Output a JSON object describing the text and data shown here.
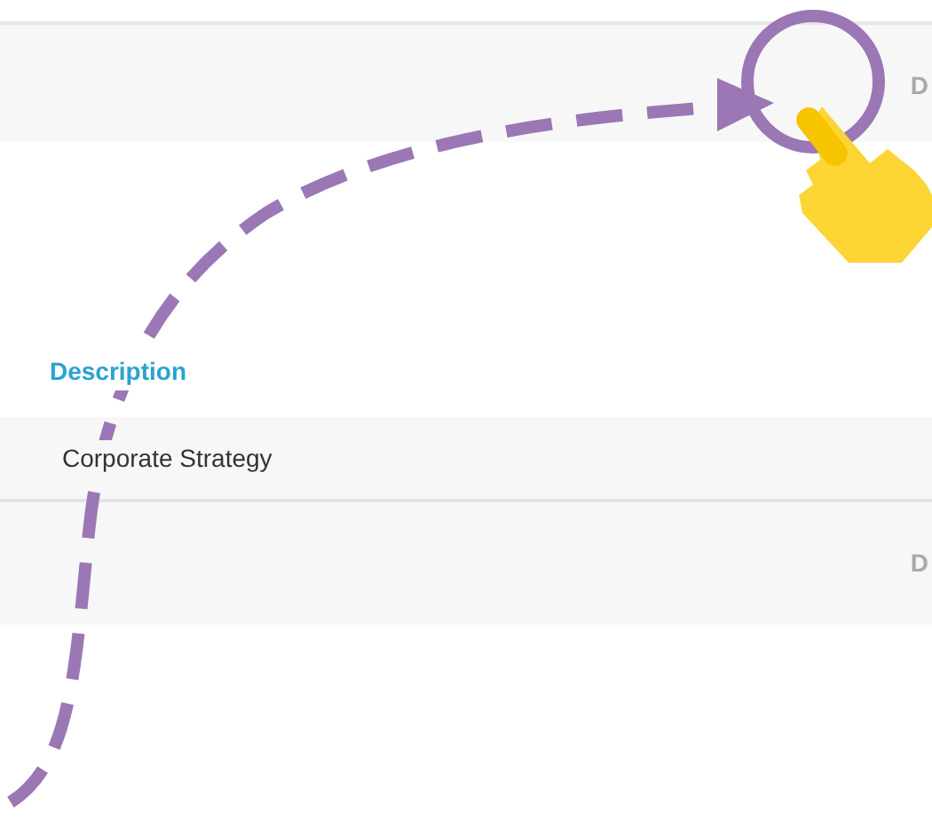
{
  "top_row": {
    "column_2": "D"
  },
  "description_header": "Description",
  "description_row": "Corporate Strategy",
  "bottom_row": {
    "column_2": "D"
  }
}
